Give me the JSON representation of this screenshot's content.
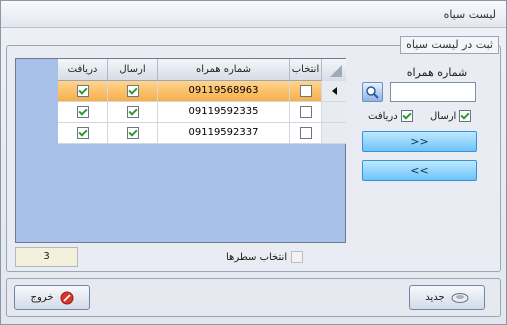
{
  "window": {
    "title": "لیست سیاه"
  },
  "group": {
    "caption": "ثبت در لیست سیاه"
  },
  "grid": {
    "columns": {
      "select": "انتخاب",
      "phone": "شماره همراه",
      "send": "ارسال",
      "receive": "دریافت"
    },
    "rows": [
      {
        "selected": false,
        "phone": "09119568963",
        "send": true,
        "receive": true,
        "current": true
      },
      {
        "selected": false,
        "phone": "09119592335",
        "send": true,
        "receive": true,
        "current": false
      },
      {
        "selected": false,
        "phone": "09119592337",
        "send": true,
        "receive": true,
        "current": false
      }
    ]
  },
  "form": {
    "phone_label": "شماره همراه",
    "phone_value": "",
    "send_label": "ارسال",
    "send_checked": true,
    "receive_label": "دریافت",
    "receive_checked": true,
    "add_button": ">>",
    "remove_button": "<<"
  },
  "footer": {
    "row_count": "3",
    "select_rows_label": "انتخاب سطرها"
  },
  "buttons": {
    "new_label": "جدید",
    "exit_label": "خروج"
  },
  "colors": {
    "selected_row": "#f7ae4a",
    "grid_background": "#a6c0e8",
    "action_button": "#6cc4fb",
    "exit_icon": "#d9332b"
  },
  "icons": {
    "lookup": "contact-lookup-icon",
    "new": "new-record-icon",
    "exit": "exit-icon",
    "row_pointer": "row-pointer-icon"
  }
}
